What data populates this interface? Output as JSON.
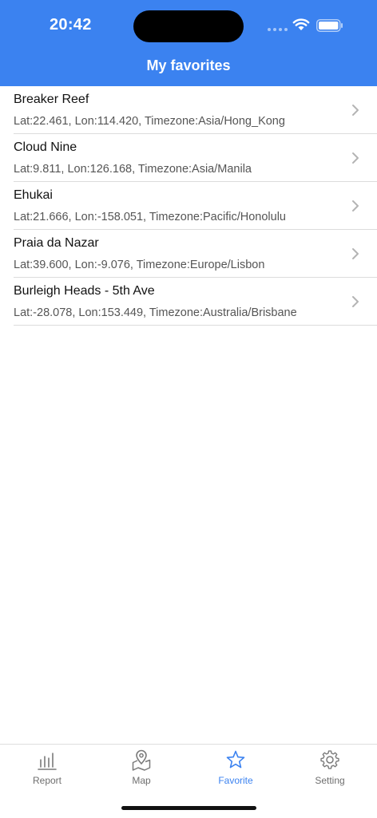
{
  "status_bar": {
    "time": "20:42"
  },
  "nav": {
    "title": "My favorites"
  },
  "favorites": [
    {
      "name": "Breaker Reef",
      "detail": "Lat:22.461, Lon:114.420, Timezone:Asia/Hong_Kong"
    },
    {
      "name": "Cloud Nine",
      "detail": "Lat:9.811, Lon:126.168, Timezone:Asia/Manila"
    },
    {
      "name": "Ehukai",
      "detail": "Lat:21.666, Lon:-158.051, Timezone:Pacific/Honolulu"
    },
    {
      "name": "Praia da Nazar",
      "detail": "Lat:39.600, Lon:-9.076, Timezone:Europe/Lisbon"
    },
    {
      "name": "Burleigh Heads - 5th Ave",
      "detail": "Lat:-28.078, Lon:153.449, Timezone:Australia/Brisbane"
    }
  ],
  "tabbar": {
    "items": [
      {
        "label": "Report",
        "icon": "chart-bars-icon"
      },
      {
        "label": "Map",
        "icon": "map-pin-icon"
      },
      {
        "label": "Favorite",
        "icon": "star-icon",
        "active": true
      },
      {
        "label": "Setting",
        "icon": "gear-icon"
      }
    ]
  },
  "colors": {
    "accent": "#3b82f0",
    "inactive": "#6e6e6e"
  }
}
